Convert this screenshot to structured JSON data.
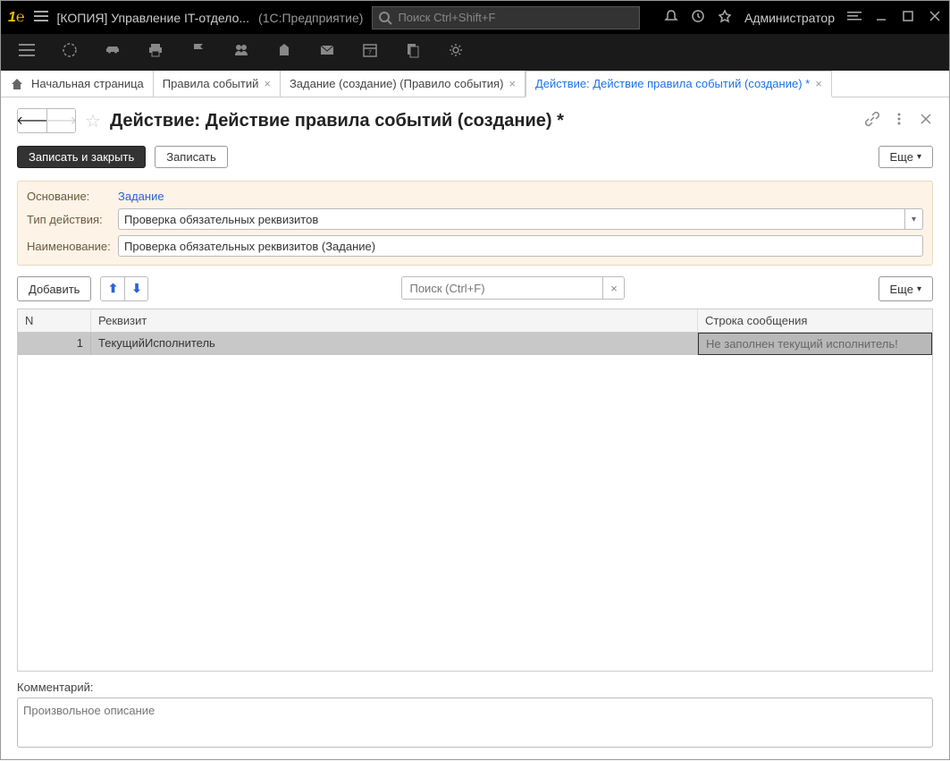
{
  "titlebar": {
    "app_title": "[КОПИЯ] Управление IT-отдело...",
    "app_subtitle": "(1С:Предприятие)",
    "search_placeholder": "Поиск Ctrl+Shift+F",
    "user": "Администратор"
  },
  "tabs": {
    "home": "Начальная страница",
    "tab1": "Правила событий",
    "tab2": "Задание (создание) (Правило события)",
    "tab3": "Действие: Действие правила событий (создание) *"
  },
  "page": {
    "title": "Действие: Действие правила событий (создание) *"
  },
  "commands": {
    "write_close": "Записать и закрыть",
    "write": "Записать",
    "more": "Еще",
    "add": "Добавить",
    "more2": "Еще"
  },
  "form": {
    "basis_label": "Основание:",
    "basis_value": "Задание",
    "type_label": "Тип действия:",
    "type_value": "Проверка обязательных реквизитов",
    "name_label": "Наименование:",
    "name_value": "Проверка обязательных реквизитов (Задание)"
  },
  "table_search_placeholder": "Поиск (Ctrl+F)",
  "table": {
    "cols": {
      "n": "N",
      "r": "Реквизит",
      "s": "Строка сообщения"
    },
    "rows": [
      {
        "n": "1",
        "r": "ТекущийИсполнитель",
        "s": "Не заполнен текущий исполнитель!"
      }
    ]
  },
  "comment": {
    "label": "Комментарий:",
    "placeholder": "Произвольное описание"
  }
}
